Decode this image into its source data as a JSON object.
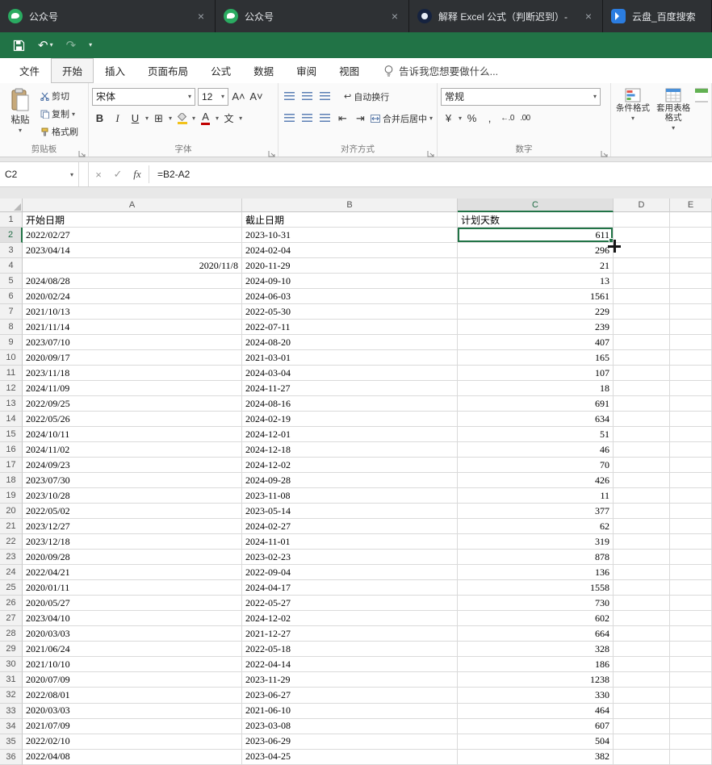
{
  "browser": {
    "tabs": [
      {
        "title": "公众号",
        "icon": "wechat",
        "closable": true
      },
      {
        "title": "公众号",
        "icon": "wechat",
        "closable": true
      },
      {
        "title": "解释 Excel 公式（判断迟到）-",
        "icon": "dark",
        "closable": true
      },
      {
        "title": "云盘_百度搜索",
        "icon": "baidu",
        "closable": false
      }
    ]
  },
  "ribbon": {
    "tabs": [
      "文件",
      "开始",
      "插入",
      "页面布局",
      "公式",
      "数据",
      "审阅",
      "视图"
    ],
    "active_tab": "开始",
    "tell_me": "告诉我您想要做什么...",
    "clipboard": {
      "label": "剪贴板",
      "paste": "粘贴",
      "cut": "剪切",
      "copy": "复制",
      "format_painter": "格式刷"
    },
    "font": {
      "label": "字体",
      "font_name": "宋体",
      "font_size": "12"
    },
    "alignment": {
      "label": "对齐方式",
      "wrap_text": "自动换行",
      "merge_center": "合并后居中"
    },
    "number": {
      "label": "数字",
      "format": "常规"
    },
    "styles": {
      "conditional": "条件格式",
      "format_table": "套用表格格式"
    }
  },
  "icons": {
    "close": "×",
    "check": "✓",
    "fx": "fx",
    "caret": "▾",
    "undo": "↶",
    "redo": "↷",
    "bold": "B",
    "italic": "I",
    "underline": "U",
    "borders": "⊞",
    "phonetic": "文",
    "font_color": "A",
    "increase_font": "A˄",
    "decrease_font": "A˅",
    "wrap_arrow": "↩",
    "indent_left": "⇤",
    "indent_right": "⇥",
    "currency": "¥",
    "percent": "%",
    "comma": ",",
    "increase_decimal": "←.0",
    "decrease_decimal": ".00"
  },
  "formula_bar": {
    "name_box": "C2",
    "formula": "=B2-A2"
  },
  "sheet": {
    "columns": [
      "A",
      "B",
      "C",
      "D",
      "E"
    ],
    "selected_column": "C",
    "selected_row": 2,
    "selected_cell": "C2",
    "headers": {
      "a": "开始日期",
      "b": "截止日期",
      "c": "计划天数"
    },
    "rows": [
      {
        "a": "2022/02/27",
        "b": "2023-10-31",
        "c": "611"
      },
      {
        "a": "2023/04/14",
        "b": "2024-02-04",
        "c": "296"
      },
      {
        "a": "2020/11/8",
        "b": "2020-11-29",
        "c": "21",
        "a_right": true
      },
      {
        "a": "2024/08/28",
        "b": "2024-09-10",
        "c": "13"
      },
      {
        "a": "2020/02/24",
        "b": "2024-06-03",
        "c": "1561"
      },
      {
        "a": "2021/10/13",
        "b": "2022-05-30",
        "c": "229"
      },
      {
        "a": "2021/11/14",
        "b": "2022-07-11",
        "c": "239"
      },
      {
        "a": "2023/07/10",
        "b": "2024-08-20",
        "c": "407"
      },
      {
        "a": "2020/09/17",
        "b": "2021-03-01",
        "c": "165"
      },
      {
        "a": "2023/11/18",
        "b": "2024-03-04",
        "c": "107"
      },
      {
        "a": "2024/11/09",
        "b": "2024-11-27",
        "c": "18"
      },
      {
        "a": "2022/09/25",
        "b": "2024-08-16",
        "c": "691"
      },
      {
        "a": "2022/05/26",
        "b": "2024-02-19",
        "c": "634"
      },
      {
        "a": "2024/10/11",
        "b": "2024-12-01",
        "c": "51"
      },
      {
        "a": "2024/11/02",
        "b": "2024-12-18",
        "c": "46"
      },
      {
        "a": "2024/09/23",
        "b": "2024-12-02",
        "c": "70"
      },
      {
        "a": "2023/07/30",
        "b": "2024-09-28",
        "c": "426"
      },
      {
        "a": "2023/10/28",
        "b": "2023-11-08",
        "c": "11"
      },
      {
        "a": "2022/05/02",
        "b": "2023-05-14",
        "c": "377"
      },
      {
        "a": "2023/12/27",
        "b": "2024-02-27",
        "c": "62"
      },
      {
        "a": "2023/12/18",
        "b": "2024-11-01",
        "c": "319"
      },
      {
        "a": "2020/09/28",
        "b": "2023-02-23",
        "c": "878"
      },
      {
        "a": "2022/04/21",
        "b": "2022-09-04",
        "c": "136"
      },
      {
        "a": "2020/01/11",
        "b": "2024-04-17",
        "c": "1558"
      },
      {
        "a": "2020/05/27",
        "b": "2022-05-27",
        "c": "730"
      },
      {
        "a": "2023/04/10",
        "b": "2024-12-02",
        "c": "602"
      },
      {
        "a": "2020/03/03",
        "b": "2021-12-27",
        "c": "664"
      },
      {
        "a": "2021/06/24",
        "b": "2022-05-18",
        "c": "328"
      },
      {
        "a": "2021/10/10",
        "b": "2022-04-14",
        "c": "186"
      },
      {
        "a": "2020/07/09",
        "b": "2023-11-29",
        "c": "1238"
      },
      {
        "a": "2022/08/01",
        "b": "2023-06-27",
        "c": "330"
      },
      {
        "a": "2020/03/03",
        "b": "2021-06-10",
        "c": "464"
      },
      {
        "a": "2021/07/09",
        "b": "2023-03-08",
        "c": "607"
      },
      {
        "a": "2022/02/10",
        "b": "2023-06-29",
        "c": "504"
      },
      {
        "a": "2022/04/08",
        "b": "2023-04-25",
        "c": "382"
      }
    ]
  },
  "colors": {
    "excel_green": "#217346",
    "tab_bar_bg": "#1f2125",
    "selection_border": "#217346",
    "grid_line": "#dadada",
    "header_bg": "#f2f2f2",
    "font_color_red": "#c00000"
  }
}
